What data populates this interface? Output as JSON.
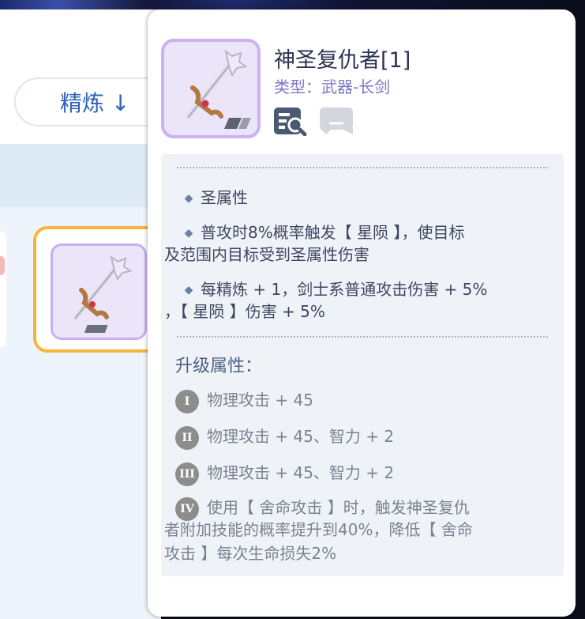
{
  "background": {
    "refine_button_label": "精炼 ↓"
  },
  "tooltip": {
    "item_name": "神圣复仇者[1]",
    "item_type": "类型：武器-长剑",
    "buttons": {
      "detail_icon": "magnify-document-icon",
      "chat_icon": "chat-bubble-icon"
    },
    "effects": [
      "圣属性",
      "普攻时8%概率触发【 星陨 】，使目标",
      "及范围内目标受到圣属性伤害",
      "每精炼 + 1，剑士系普通攻击伤害 + 5%",
      "，【 星陨 】伤害 + 5%"
    ],
    "upgrade_title": "升级属性：",
    "upgrades": [
      {
        "level": "I",
        "text": "物理攻击 + 45"
      },
      {
        "level": "II",
        "text": "物理攻击 + 45、智力 + 2"
      },
      {
        "level": "III",
        "text": "物理攻击 + 45、智力 + 2"
      },
      {
        "level": "IV",
        "text": "使用【 舍命攻击 】时，触发神圣复仇",
        "text2": "者附加技能的概率提升到40%，降低【 舍命",
        "text3": "攻击 】每次生命损失2%"
      }
    ]
  },
  "colors": {
    "accent_blue": "#2d63b8",
    "type_purple": "#7b76c9",
    "selected_border": "#f4b63e",
    "frame_purple": "#cdb2f2"
  }
}
